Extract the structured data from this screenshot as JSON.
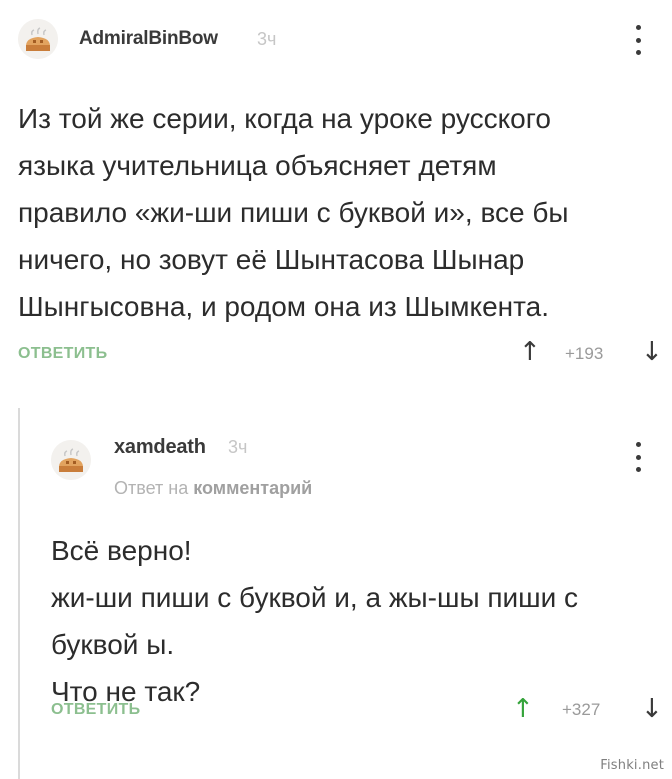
{
  "comment": {
    "author": "AdmiralBinBow",
    "time": "3ч",
    "lines": [
      "Из той же серии, когда на уроке русского",
      "языка учительница объясняет детям",
      "правило «жи-ши пиши с буквой и», все бы",
      "ничего, но зовут её Шынтасова Шынар",
      "Шынгысовна, и родом она из Шымкента."
    ],
    "reply_label": "ОТВЕТИТЬ",
    "vote_up_icon": "↑",
    "vote_count": "+193",
    "vote_down_icon": "↓",
    "avatar_icon": "pie-avatar-icon"
  },
  "reply": {
    "author": "xamdeath",
    "time": "3ч",
    "reply_to_prefix": "Ответ на",
    "reply_to_link": "комментарий",
    "lines": [
      "Всё верно!",
      "жи-ши пиши с буквой и, а жы-шы пиши с",
      "буквой ы.",
      "Что не так?"
    ],
    "reply_label": "ОТВЕТИТЬ",
    "vote_up_icon": "↑",
    "vote_count": "+327",
    "vote_down_icon": "↓",
    "avatar_icon": "pie-avatar-icon"
  },
  "colors": {
    "reply_link": "#8cbf8f",
    "upvoted": "#35a33b",
    "time": "#c6c6c6"
  },
  "watermark": "Fishki.net"
}
